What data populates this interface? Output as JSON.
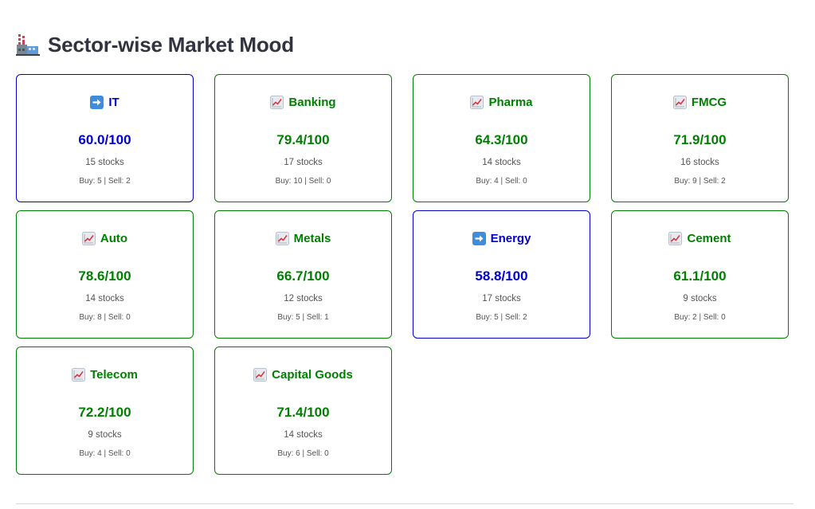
{
  "header": {
    "icon": "factory-icon",
    "title": "Sector-wise Market Mood"
  },
  "colors": {
    "positive": "#008000",
    "neutral": "#0000cc"
  },
  "sectors": [
    {
      "name": "IT",
      "score": "60.0/100",
      "stocks": "15 stocks",
      "buysell": "Buy: 5 | Sell: 2",
      "mood": "neutral",
      "icon": "right-arrow-icon"
    },
    {
      "name": "Banking",
      "score": "79.4/100",
      "stocks": "17 stocks",
      "buysell": "Buy: 10 | Sell: 0",
      "mood": "positive",
      "icon": "chart-increasing-icon"
    },
    {
      "name": "Pharma",
      "score": "64.3/100",
      "stocks": "14 stocks",
      "buysell": "Buy: 4 | Sell: 0",
      "mood": "positive",
      "icon": "chart-increasing-icon"
    },
    {
      "name": "FMCG",
      "score": "71.9/100",
      "stocks": "16 stocks",
      "buysell": "Buy: 9 | Sell: 2",
      "mood": "positive",
      "icon": "chart-increasing-icon"
    },
    {
      "name": "Auto",
      "score": "78.6/100",
      "stocks": "14 stocks",
      "buysell": "Buy: 8 | Sell: 0",
      "mood": "positive",
      "icon": "chart-increasing-icon"
    },
    {
      "name": "Metals",
      "score": "66.7/100",
      "stocks": "12 stocks",
      "buysell": "Buy: 5 | Sell: 1",
      "mood": "positive",
      "icon": "chart-increasing-icon"
    },
    {
      "name": "Energy",
      "score": "58.8/100",
      "stocks": "17 stocks",
      "buysell": "Buy: 5 | Sell: 2",
      "mood": "neutral",
      "icon": "right-arrow-icon"
    },
    {
      "name": "Cement",
      "score": "61.1/100",
      "stocks": "9 stocks",
      "buysell": "Buy: 2 | Sell: 0",
      "mood": "positive",
      "icon": "chart-increasing-icon"
    },
    {
      "name": "Telecom",
      "score": "72.2/100",
      "stocks": "9 stocks",
      "buysell": "Buy: 4 | Sell: 0",
      "mood": "positive",
      "icon": "chart-increasing-icon"
    },
    {
      "name": "Capital Goods",
      "score": "71.4/100",
      "stocks": "14 stocks",
      "buysell": "Buy: 6 | Sell: 0",
      "mood": "positive",
      "icon": "chart-increasing-icon"
    }
  ]
}
